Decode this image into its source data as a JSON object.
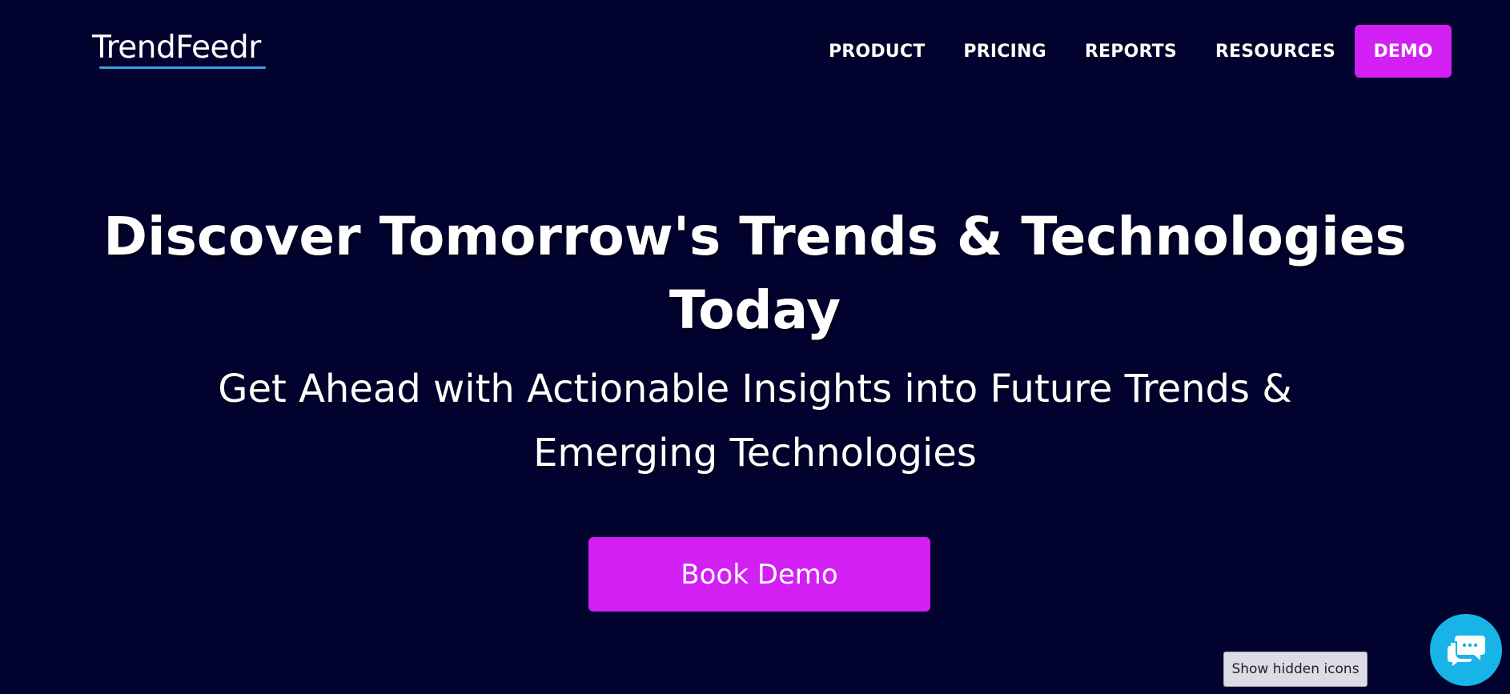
{
  "header": {
    "logo_text": "TrendFeedr",
    "nav": {
      "product": "PRODUCT",
      "pricing": "PRICING",
      "reports": "REPORTS",
      "resources": "RESOURCES",
      "demo": "DEMO"
    }
  },
  "hero": {
    "title": "Discover Tomorrow's Trends & Technologies Today",
    "subtitle": "Get Ahead with Actionable Insights into Future Trends & Emerging Technologies",
    "cta_label": "Book Demo"
  },
  "tooltip": {
    "text": "Show hidden icons"
  },
  "chat": {
    "icon": "chat-bubbles-icon"
  },
  "colors": {
    "background": "#02022e",
    "accent": "#d21ff3",
    "logo_underline": "#3aa0e8",
    "chat": "#18b4e8"
  }
}
